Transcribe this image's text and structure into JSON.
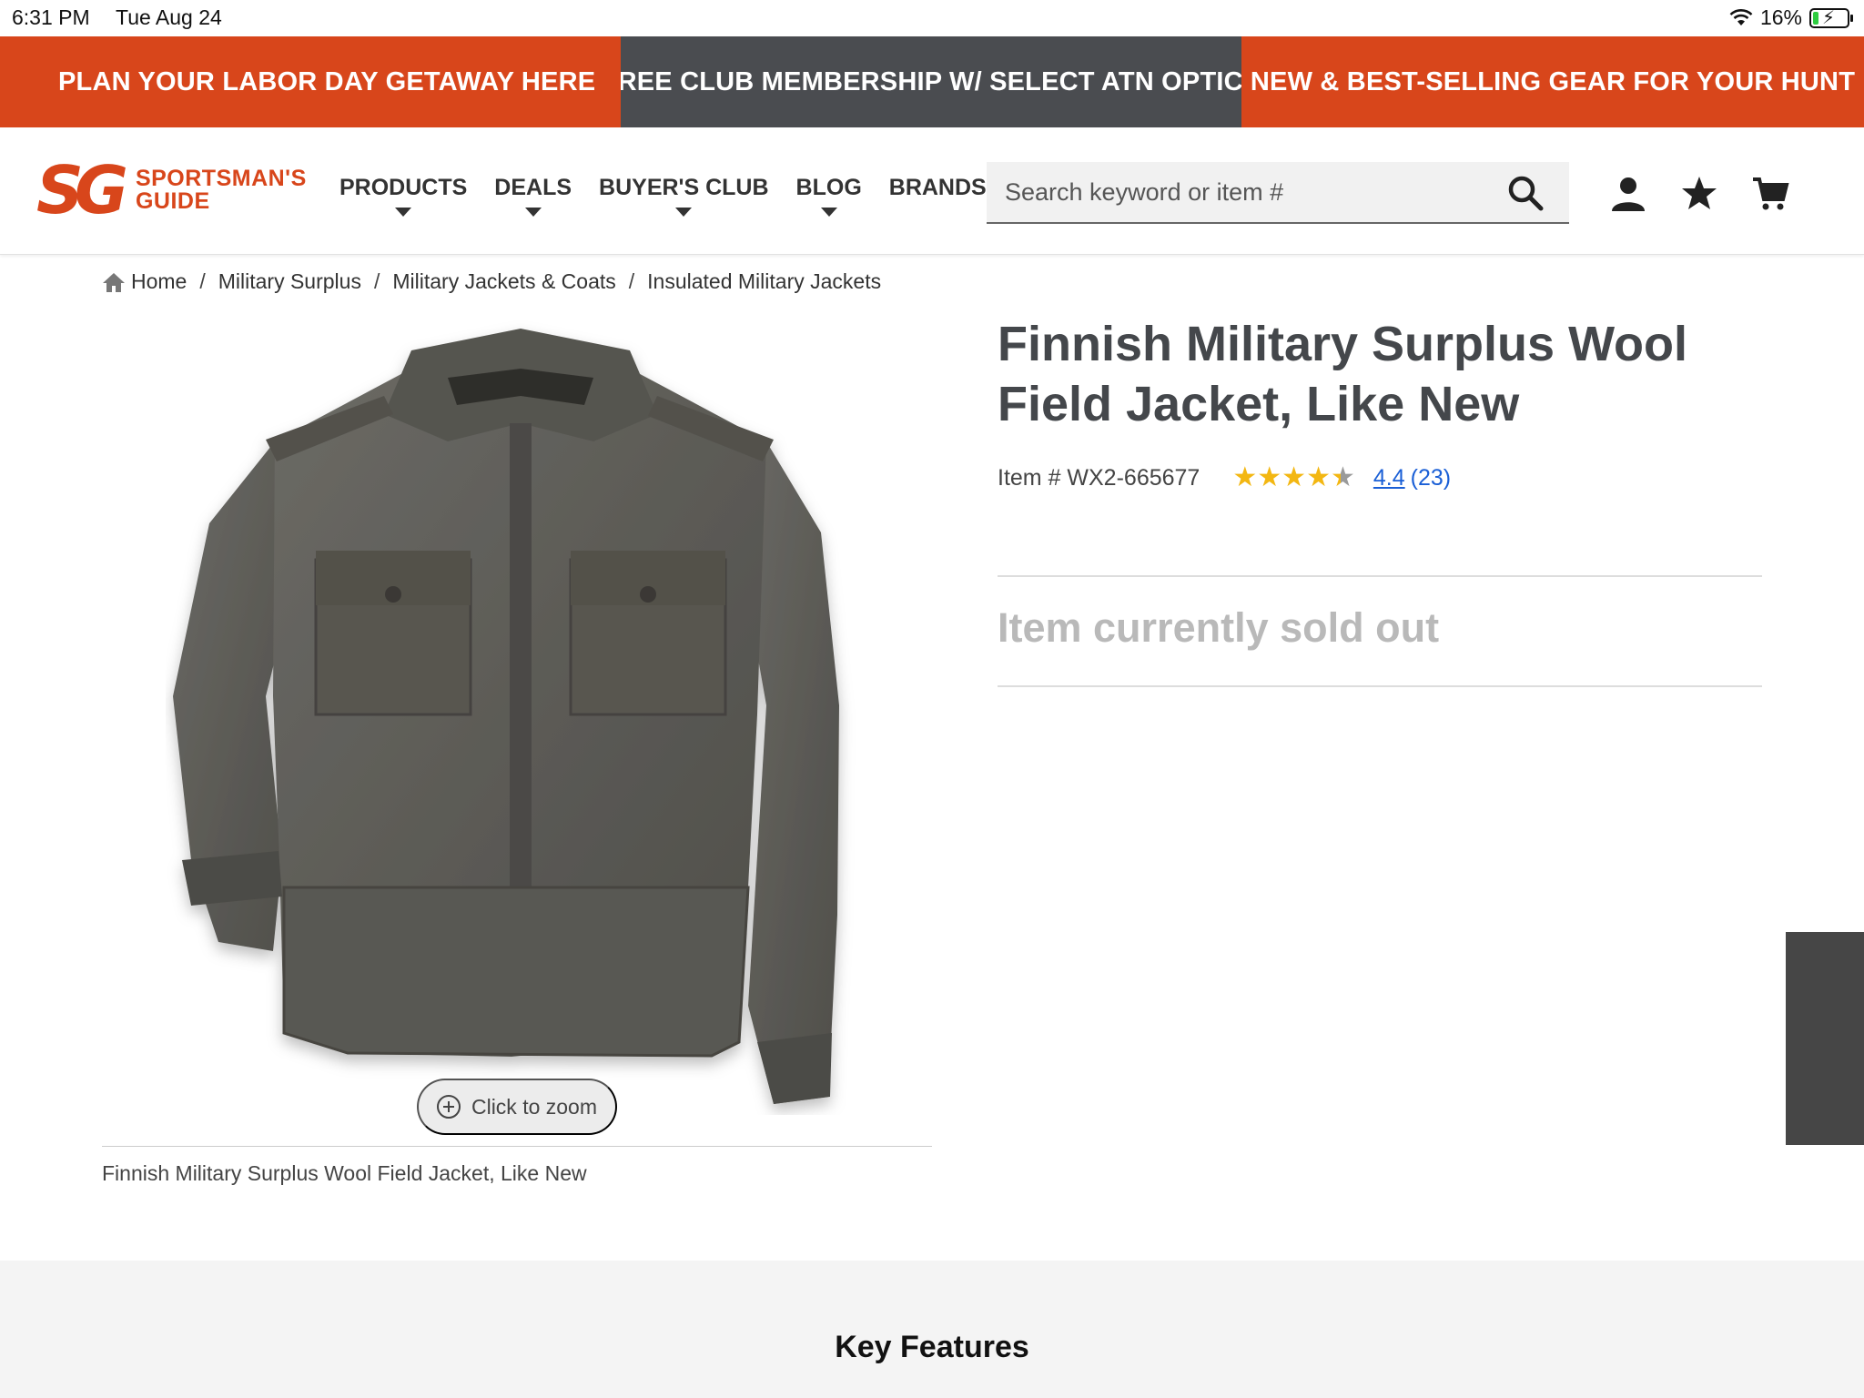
{
  "status_bar": {
    "time": "6:31 PM",
    "date": "Tue Aug 24",
    "battery": "16%",
    "battery_level": 0.16
  },
  "promo": {
    "left": "PLAN YOUR LABOR DAY GETAWAY HERE",
    "center": "FREE CLUB MEMBERSHIP W/ SELECT ATN OPTICS",
    "right": "NEW & BEST-SELLING GEAR FOR YOUR HUNT",
    "colors": {
      "orange": "#d8461b",
      "gray": "#4a4c50"
    }
  },
  "header": {
    "logo_mark": "SG",
    "logo_line1": "SPORTSMAN'S",
    "logo_line2": "GUIDE",
    "nav": [
      {
        "label": "PRODUCTS"
      },
      {
        "label": "DEALS"
      },
      {
        "label": "BUYER'S CLUB"
      },
      {
        "label": "BLOG"
      },
      {
        "label": "BRANDS"
      }
    ],
    "search_placeholder": "Search keyword or item #",
    "icons": [
      "account-icon",
      "wishlist-star-icon",
      "cart-icon"
    ]
  },
  "breadcrumb": {
    "items": [
      "Home",
      "Military Surplus",
      "Military Jackets & Coats",
      "Insulated Military Jackets"
    ],
    "separator": "/"
  },
  "product": {
    "title": "Finnish Military Surplus Wool Field Jacket, Like New",
    "item_number": "Item # WX2-665677",
    "rating": "4.4",
    "rating_value": 4.4,
    "review_count": "(23)",
    "status": "Item currently sold out",
    "zoom_label": "Click to zoom",
    "image_caption": "Finnish Military Surplus Wool Field Jacket, Like New"
  },
  "sections": {
    "key_features": "Key Features"
  }
}
